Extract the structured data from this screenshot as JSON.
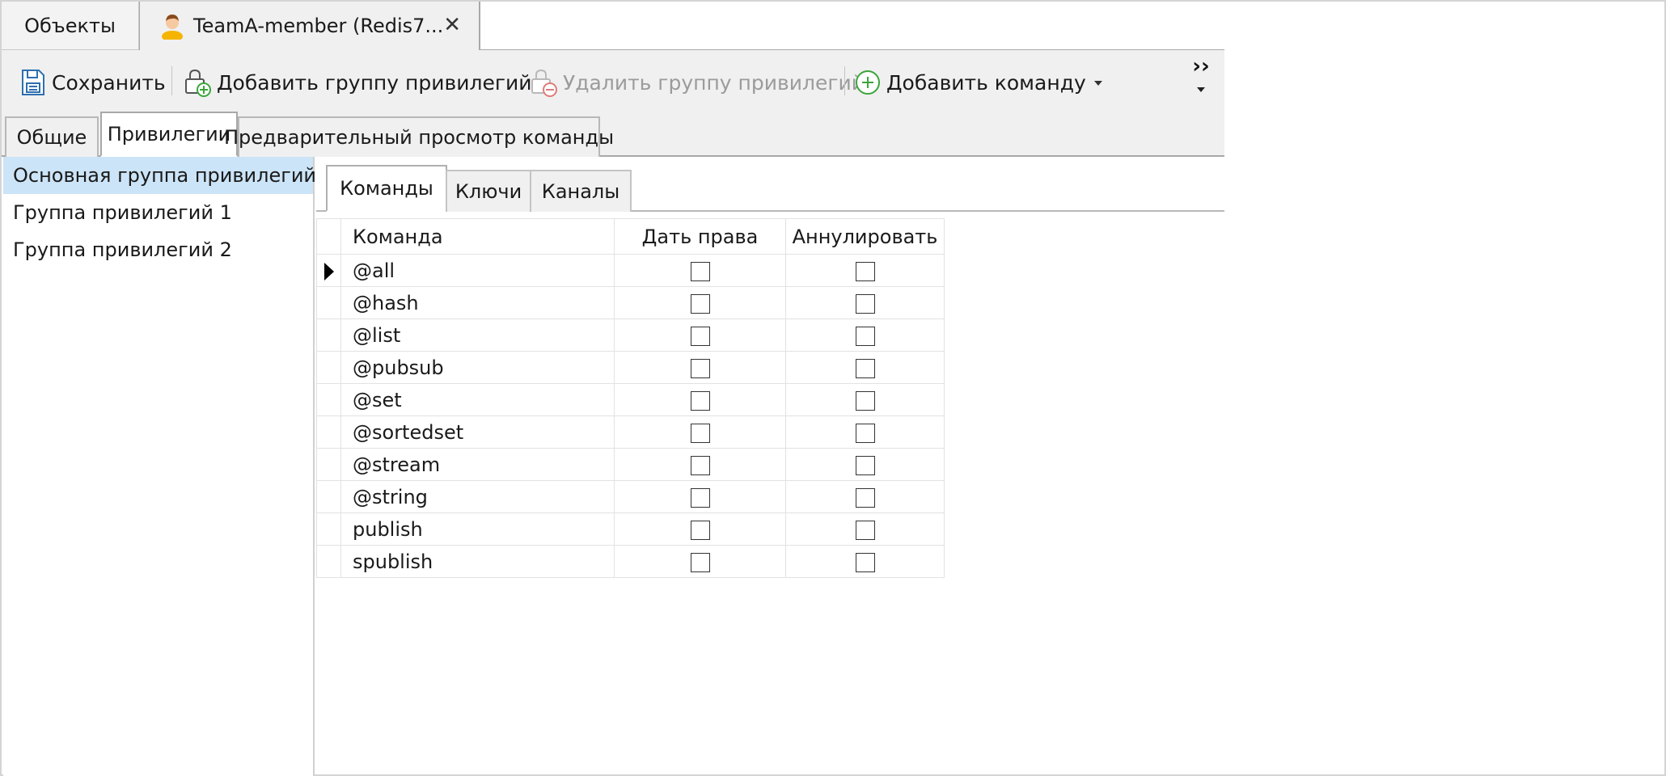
{
  "doc_tabs": {
    "objects_label": "Объекты",
    "active_label": "TeamA-member (Redis7...",
    "close_glyph": "✕"
  },
  "toolbar": {
    "save_label": "Сохранить",
    "add_group_label": "Добавить группу привилегий",
    "delete_group_label": "Удалить группу привилегий",
    "add_command_label": "Добавить команду",
    "overflow_glyph": "››"
  },
  "section_tabs": [
    "Общие",
    "Привилегии",
    "Предварительный просмотр команды"
  ],
  "groups": [
    {
      "label": "Основная группа привилегий",
      "selected": true
    },
    {
      "label": "Группа привилегий 1",
      "selected": false
    },
    {
      "label": "Группа привилегий 2",
      "selected": false
    }
  ],
  "inner_tabs": [
    "Команды",
    "Ключи",
    "Каналы"
  ],
  "table": {
    "headers": {
      "command": "Команда",
      "grant": "Дать права",
      "revoke": "Аннулировать"
    },
    "rows": [
      {
        "command": "@all",
        "grant": false,
        "revoke": false
      },
      {
        "command": "@hash",
        "grant": false,
        "revoke": false
      },
      {
        "command": "@list",
        "grant": false,
        "revoke": false
      },
      {
        "command": "@pubsub",
        "grant": false,
        "revoke": false
      },
      {
        "command": "@set",
        "grant": false,
        "revoke": false
      },
      {
        "command": "@sortedset",
        "grant": false,
        "revoke": false
      },
      {
        "command": "@stream",
        "grant": false,
        "revoke": false
      },
      {
        "command": "@string",
        "grant": false,
        "revoke": false
      },
      {
        "command": "publish",
        "grant": false,
        "revoke": false
      },
      {
        "command": "spublish",
        "grant": false,
        "revoke": false
      }
    ]
  },
  "colors": {
    "selection": "#cce4f7",
    "toolbar_bg": "#f0f0f0",
    "add_icon_green": "#3aa53a",
    "delete_icon_red": "#e07b7b"
  }
}
